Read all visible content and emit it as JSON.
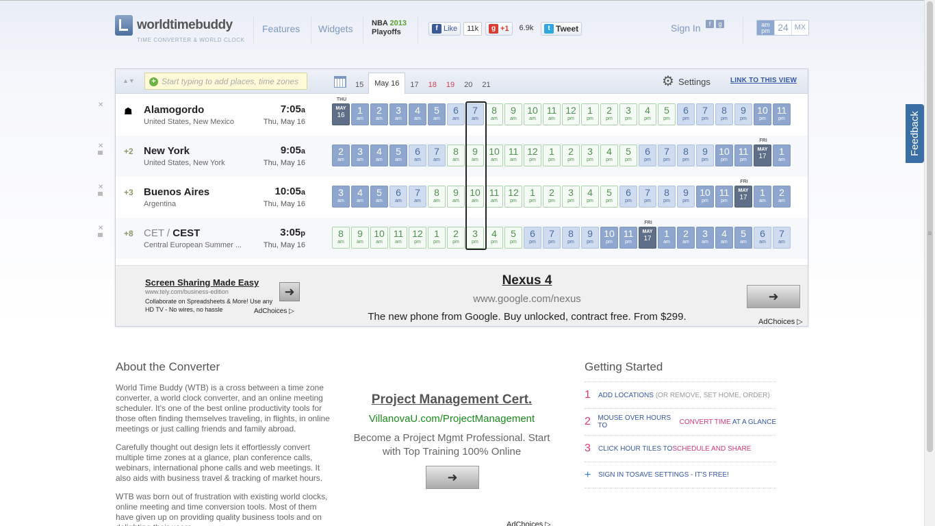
{
  "header": {
    "logo_name": "worldtimebuddy",
    "logo_tagline": "TIME CONVERTER & WORLD CLOCK",
    "nav": [
      "Features",
      "Widgets"
    ],
    "promo_line1": "NBA",
    "promo_year": "2013",
    "promo_line2": "Playoffs",
    "like_label": "Like",
    "like_count": "11k",
    "gplus_label": "+1",
    "gplus_count": "6.9k",
    "tweet_label": "Tweet",
    "signin": "Sign In",
    "format_options": [
      "am pm",
      "24",
      "MX"
    ]
  },
  "toolbar": {
    "search_placeholder": "Start typing to add places, time zones",
    "days": [
      {
        "label": "15",
        "weekend": false
      },
      {
        "label": "May 16",
        "weekend": false,
        "current": true
      },
      {
        "label": "17",
        "weekend": false
      },
      {
        "label": "18",
        "weekend": true
      },
      {
        "label": "19",
        "weekend": true
      },
      {
        "label": "20",
        "weekend": false
      },
      {
        "label": "21",
        "weekend": false
      }
    ],
    "settings_label": "Settings",
    "link_label": "LINK TO THIS VIEW"
  },
  "locations": [
    {
      "offset": "",
      "home": true,
      "city": "Alamogordo",
      "tz_prefix": "",
      "country": "United States, New Mexico",
      "time": "7:05",
      "ampm": "a",
      "date": "Thu, May 16",
      "tiles": [
        {
          "type": "date",
          "mon": "MAY",
          "day": "16",
          "label": "THU"
        },
        {
          "h": "1",
          "s": "am",
          "c": "n"
        },
        {
          "h": "2",
          "s": "am",
          "c": "n"
        },
        {
          "h": "3",
          "s": "am",
          "c": "n"
        },
        {
          "h": "4",
          "s": "am",
          "c": "n"
        },
        {
          "h": "5",
          "s": "am",
          "c": "n"
        },
        {
          "h": "6",
          "s": "am",
          "c": "m"
        },
        {
          "h": "7",
          "s": "am",
          "c": "m"
        },
        {
          "h": "8",
          "s": "am",
          "c": "d"
        },
        {
          "h": "9",
          "s": "am",
          "c": "d"
        },
        {
          "h": "10",
          "s": "am",
          "c": "d"
        },
        {
          "h": "11",
          "s": "am",
          "c": "d"
        },
        {
          "h": "12",
          "s": "pm",
          "c": "d"
        },
        {
          "h": "1",
          "s": "pm",
          "c": "d"
        },
        {
          "h": "2",
          "s": "pm",
          "c": "d"
        },
        {
          "h": "3",
          "s": "pm",
          "c": "d"
        },
        {
          "h": "4",
          "s": "pm",
          "c": "d"
        },
        {
          "h": "5",
          "s": "pm",
          "c": "d"
        },
        {
          "h": "6",
          "s": "pm",
          "c": "m"
        },
        {
          "h": "7",
          "s": "pm",
          "c": "m"
        },
        {
          "h": "8",
          "s": "pm",
          "c": "m"
        },
        {
          "h": "9",
          "s": "pm",
          "c": "m"
        },
        {
          "h": "10",
          "s": "pm",
          "c": "n"
        },
        {
          "h": "11",
          "s": "pm",
          "c": "n"
        }
      ]
    },
    {
      "offset": "+2",
      "home": false,
      "city": "New York",
      "tz_prefix": "",
      "country": "United States, New York",
      "time": "9:05",
      "ampm": "a",
      "date": "Thu, May 16",
      "tiles": [
        {
          "h": "2",
          "s": "am",
          "c": "n"
        },
        {
          "h": "3",
          "s": "am",
          "c": "n"
        },
        {
          "h": "4",
          "s": "am",
          "c": "n"
        },
        {
          "h": "5",
          "s": "am",
          "c": "n"
        },
        {
          "h": "6",
          "s": "am",
          "c": "m"
        },
        {
          "h": "7",
          "s": "am",
          "c": "m"
        },
        {
          "h": "8",
          "s": "am",
          "c": "d"
        },
        {
          "h": "9",
          "s": "am",
          "c": "d"
        },
        {
          "h": "10",
          "s": "am",
          "c": "d"
        },
        {
          "h": "11",
          "s": "am",
          "c": "d"
        },
        {
          "h": "12",
          "s": "pm",
          "c": "d"
        },
        {
          "h": "1",
          "s": "pm",
          "c": "d"
        },
        {
          "h": "2",
          "s": "pm",
          "c": "d"
        },
        {
          "h": "3",
          "s": "pm",
          "c": "d"
        },
        {
          "h": "4",
          "s": "pm",
          "c": "d"
        },
        {
          "h": "5",
          "s": "pm",
          "c": "d"
        },
        {
          "h": "6",
          "s": "pm",
          "c": "m"
        },
        {
          "h": "7",
          "s": "pm",
          "c": "m"
        },
        {
          "h": "8",
          "s": "pm",
          "c": "m"
        },
        {
          "h": "9",
          "s": "pm",
          "c": "m"
        },
        {
          "h": "10",
          "s": "pm",
          "c": "n"
        },
        {
          "h": "11",
          "s": "pm",
          "c": "n"
        },
        {
          "type": "date",
          "mon": "MAY",
          "day": "17",
          "label": "FRI"
        },
        {
          "h": "1",
          "s": "am",
          "c": "n"
        }
      ]
    },
    {
      "offset": "+3",
      "home": false,
      "city": "Buenos Aires",
      "tz_prefix": "",
      "country": "Argentina",
      "time": "10:05",
      "ampm": "a",
      "date": "Thu, May 16",
      "tiles": [
        {
          "h": "3",
          "s": "am",
          "c": "n"
        },
        {
          "h": "4",
          "s": "am",
          "c": "n"
        },
        {
          "h": "5",
          "s": "am",
          "c": "n"
        },
        {
          "h": "6",
          "s": "am",
          "c": "m"
        },
        {
          "h": "7",
          "s": "am",
          "c": "m"
        },
        {
          "h": "8",
          "s": "am",
          "c": "d"
        },
        {
          "h": "9",
          "s": "am",
          "c": "d"
        },
        {
          "h": "10",
          "s": "am",
          "c": "d"
        },
        {
          "h": "11",
          "s": "am",
          "c": "d"
        },
        {
          "h": "12",
          "s": "pm",
          "c": "d"
        },
        {
          "h": "1",
          "s": "pm",
          "c": "d"
        },
        {
          "h": "2",
          "s": "pm",
          "c": "d"
        },
        {
          "h": "3",
          "s": "pm",
          "c": "d"
        },
        {
          "h": "4",
          "s": "pm",
          "c": "d"
        },
        {
          "h": "5",
          "s": "pm",
          "c": "d"
        },
        {
          "h": "6",
          "s": "pm",
          "c": "m"
        },
        {
          "h": "7",
          "s": "pm",
          "c": "m"
        },
        {
          "h": "8",
          "s": "pm",
          "c": "m"
        },
        {
          "h": "9",
          "s": "pm",
          "c": "m"
        },
        {
          "h": "10",
          "s": "pm",
          "c": "n"
        },
        {
          "h": "11",
          "s": "pm",
          "c": "n"
        },
        {
          "type": "date",
          "mon": "MAY",
          "day": "17",
          "label": "FRI"
        },
        {
          "h": "1",
          "s": "am",
          "c": "n"
        },
        {
          "h": "2",
          "s": "am",
          "c": "n"
        }
      ]
    },
    {
      "offset": "+8",
      "home": false,
      "city": "CEST",
      "tz_prefix": "CET / ",
      "country": "Central European Summer ...",
      "time": "3:05",
      "ampm": "p",
      "date": "Thu, May 16",
      "tiles": [
        {
          "h": "8",
          "s": "am",
          "c": "d"
        },
        {
          "h": "9",
          "s": "am",
          "c": "d"
        },
        {
          "h": "10",
          "s": "am",
          "c": "d"
        },
        {
          "h": "11",
          "s": "am",
          "c": "d"
        },
        {
          "h": "12",
          "s": "pm",
          "c": "d"
        },
        {
          "h": "1",
          "s": "pm",
          "c": "d"
        },
        {
          "h": "2",
          "s": "pm",
          "c": "d"
        },
        {
          "h": "3",
          "s": "pm",
          "c": "d"
        },
        {
          "h": "4",
          "s": "pm",
          "c": "d"
        },
        {
          "h": "5",
          "s": "pm",
          "c": "d"
        },
        {
          "h": "6",
          "s": "pm",
          "c": "m"
        },
        {
          "h": "7",
          "s": "pm",
          "c": "m"
        },
        {
          "h": "8",
          "s": "pm",
          "c": "m"
        },
        {
          "h": "9",
          "s": "pm",
          "c": "m"
        },
        {
          "h": "10",
          "s": "pm",
          "c": "n"
        },
        {
          "h": "11",
          "s": "pm",
          "c": "n"
        },
        {
          "type": "date",
          "mon": "MAY",
          "day": "17",
          "label": "FRI"
        },
        {
          "h": "1",
          "s": "am",
          "c": "n"
        },
        {
          "h": "2",
          "s": "am",
          "c": "n"
        },
        {
          "h": "3",
          "s": "am",
          "c": "n"
        },
        {
          "h": "4",
          "s": "am",
          "c": "n"
        },
        {
          "h": "5",
          "s": "am",
          "c": "n"
        },
        {
          "h": "6",
          "s": "am",
          "c": "m"
        },
        {
          "h": "7",
          "s": "am",
          "c": "m"
        }
      ]
    }
  ],
  "ads": {
    "small_title": "Screen Sharing Made Easy",
    "small_url": "www.tely.com/business-edition",
    "small_desc": "Collaborate on Spreadsheets & More! Use any HD TV - No wires, no hassle",
    "adchoices": "AdChoices",
    "big_title": "Nexus 4",
    "big_url": "www.google.com/nexus",
    "big_desc": "The new phone from Google. Buy unlocked, contract free. From $299.",
    "pm_title": "Project Management Cert.",
    "pm_url": "VillanovaU.com/ProjectManagement",
    "pm_desc": "Become a Project Mgmt Professional. Start with Top Training 100% Online"
  },
  "feedback": "Feedback",
  "about": {
    "heading": "About the Converter",
    "p1": "World Time Buddy (WTB) is a cross between a time zone converter, a world clock converter, and an online meeting scheduler. It's one of the best online productivity tools for those often finding themselves traveling, in flights, in online meetings or just calling friends and family abroad.",
    "p2": "Carefully thought out design lets it effortlessly convert multiple time zones at a glance, plan conference calls, webinars, international phone calls and web meetings. It also aids with business travel & tracking of market hours.",
    "p3": "WTB was born out of frustration with existing world clocks, online meeting and time conversion tools. Most of them have given up on providing quality business tools and on delighting their users."
  },
  "getting_started": {
    "heading": "Getting Started",
    "steps": [
      {
        "num": "1",
        "a": "ADD LOCATIONS",
        "b": " (OR REMOVE, SET HOME, ORDER)",
        "c": ""
      },
      {
        "num": "2",
        "a": "MOUSE OVER HOURS TO ",
        "b": "CONVERT TIME",
        "c": " AT A GLANCE"
      },
      {
        "num": "3",
        "a": "CLICK HOUR TILES TO ",
        "b": "SCHEDULE AND SHARE",
        "c": ""
      },
      {
        "num": "+",
        "a": "SIGN IN TO ",
        "b": "SAVE SETTINGS",
        "c": " - IT'S FREE!"
      }
    ]
  }
}
